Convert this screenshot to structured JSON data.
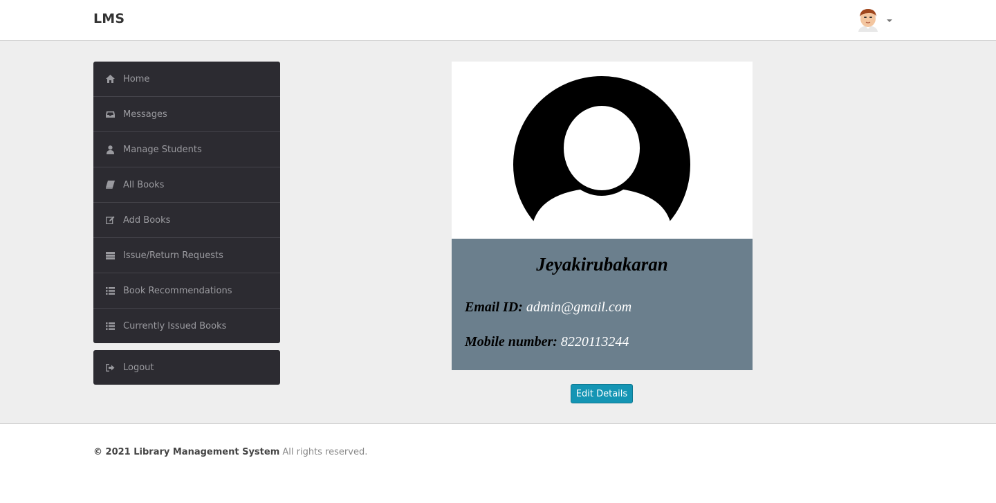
{
  "header": {
    "brand": "LMS",
    "user_avatar_icon": "cartoon-man-avatar-icon"
  },
  "sidebar": {
    "items": [
      {
        "label": "Home",
        "icon": "home-icon"
      },
      {
        "label": "Messages",
        "icon": "inbox-icon"
      },
      {
        "label": "Manage Students",
        "icon": "user-icon"
      },
      {
        "label": "All Books",
        "icon": "book-icon"
      },
      {
        "label": "Add Books",
        "icon": "edit-icon"
      },
      {
        "label": "Issue/Return Requests",
        "icon": "server-icon"
      },
      {
        "label": "Book Recommendations",
        "icon": "list-icon"
      },
      {
        "label": "Currently Issued Books",
        "icon": "list-icon"
      }
    ],
    "logout": {
      "label": "Logout",
      "icon": "sign-out-icon"
    }
  },
  "profile": {
    "name": "Jeyakirubakaran",
    "email_label": "Email ID:",
    "email": "admin@gmail.com",
    "mobile_label": "Mobile number:",
    "mobile": "8220113244",
    "edit_label": "Edit Details"
  },
  "footer": {
    "copyright": "© 2021 Library Management System",
    "rights": "All rights reserved."
  },
  "colors": {
    "sidebar_bg": "#2c2b31",
    "profile_info_bg": "#6b7f8d",
    "button_bg": "#1495b4",
    "page_bg": "#eeeeee"
  }
}
